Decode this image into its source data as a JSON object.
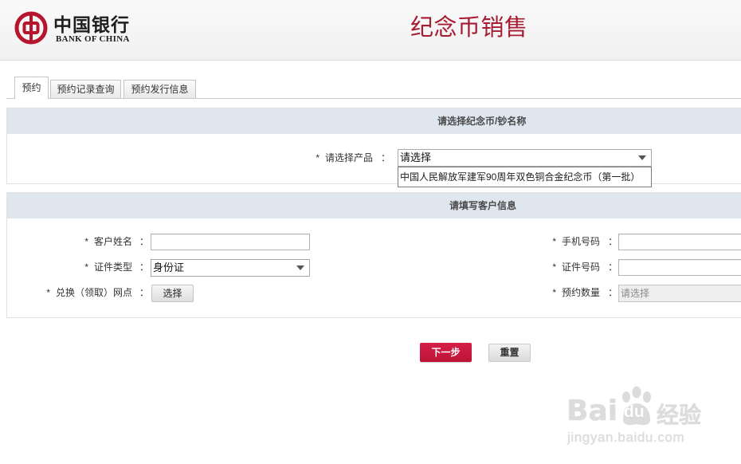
{
  "header": {
    "logo_cn": "中国银行",
    "logo_en": "BANK OF CHINA",
    "title": "纪念币销售"
  },
  "tabs": [
    {
      "label": "预约",
      "active": true
    },
    {
      "label": "预约记录查询",
      "active": false
    },
    {
      "label": "预约发行信息",
      "active": false
    }
  ],
  "form": {
    "required_mark": "*",
    "colon": "："
  },
  "product_section": {
    "heading": "请选择纪念币/钞名称",
    "product_label": "请选择产品",
    "product_select": {
      "selected": "请选择",
      "expanded": true,
      "options": [
        "中国人民解放军建军90周年双色铜合金纪念币（第一批）"
      ]
    }
  },
  "customer_section": {
    "heading": "请填写客户信息",
    "name_label": "客户姓名",
    "id_type_label": "证件类型",
    "id_type_value": "身份证",
    "branch_label": "兑换（领取）网点",
    "branch_button": "选择",
    "phone_label": "手机号码",
    "id_number_label": "证件号码",
    "quantity_label": "预约数量",
    "quantity_value": "请选择",
    "quantity_disabled": true
  },
  "actions": {
    "next": "下一步",
    "reset": "重置"
  },
  "watermark": {
    "brand_a": "Bai",
    "brand_b": "du",
    "product": "经验",
    "url": "jingyan.baidu.com"
  },
  "colors": {
    "brand_red": "#b5152d",
    "title_red": "#a61c33",
    "section_header_bg": "#dfe6ee",
    "next_button": "#c8163b",
    "reset_button": "#e4e4e4"
  },
  "icons": {
    "logo": "bank-of-china-logo-icon",
    "select_arrow": "chevron-down-icon",
    "watermark_paw": "paw-icon"
  }
}
